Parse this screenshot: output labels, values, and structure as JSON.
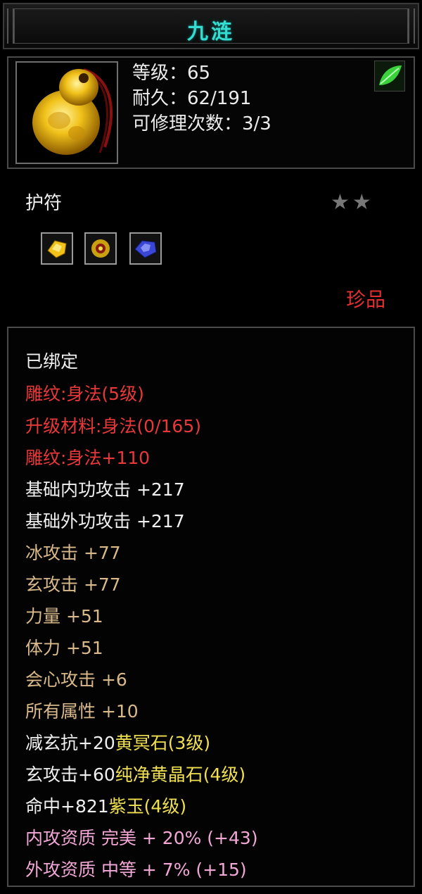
{
  "item": {
    "name": "九涟",
    "level": "等级：65",
    "durability": "耐久：62/191",
    "repair": "可修理次数：3/3",
    "type": "护符",
    "stars": "★★",
    "rarity": "珍品"
  },
  "gems": [
    "gold-crystal-icon",
    "gold-sun-icon",
    "blue-sapphire-icon"
  ],
  "properties": {
    "bound": "已绑定",
    "engrave": "雕纹:身法(5级)",
    "upgrade": "升级材料:身法(0/165)",
    "engrave_bonus": "雕纹:身法+110",
    "base_inner": "基础内功攻击 +217",
    "base_outer": "基础外功攻击 +217",
    "ice": "冰攻击 +77",
    "xuan": "玄攻击 +77",
    "strength": "力量 +51",
    "stamina": "体力 +51",
    "crit": "会心攻击 +6",
    "all": "所有属性 +10",
    "gem1_stat": "减玄抗+20",
    "gem1_name": "黄冥石(3级)",
    "gem2_stat": "玄攻击+60",
    "gem2_name": "纯净黄晶石(4级)",
    "gem3_stat": "命中+821",
    "gem3_name": "紫玉(4级)",
    "inner_quality": "内攻资质 完美 + 20% (+43)",
    "outer_quality": "外攻资质 中等 + 7% (+15)"
  },
  "colors": {
    "title": "#34dcd2",
    "red": "#e8383a",
    "tan": "#d9b98a",
    "pink": "#f2a7d6",
    "gem_name": "#f0e050"
  }
}
